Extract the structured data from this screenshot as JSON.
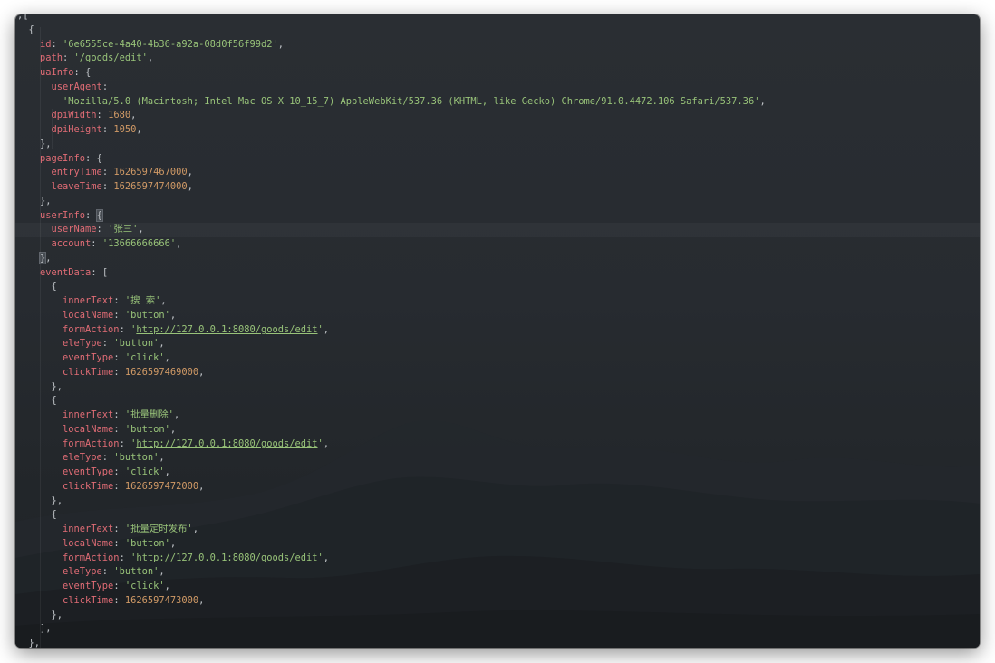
{
  "code": {
    "lines": [
      {
        "indent": 0,
        "parts": [
          {
            "t": "p",
            "v": ";["
          }
        ]
      },
      {
        "indent": 1,
        "parts": [
          {
            "t": "p",
            "v": "{"
          }
        ]
      },
      {
        "indent": 2,
        "parts": [
          {
            "t": "k",
            "v": "id"
          },
          {
            "t": "p",
            "v": ": "
          },
          {
            "t": "s",
            "v": "'6e6555ce-4a40-4b36-a92a-08d0f56f99d2'"
          },
          {
            "t": "p",
            "v": ","
          }
        ]
      },
      {
        "indent": 2,
        "parts": [
          {
            "t": "k",
            "v": "path"
          },
          {
            "t": "p",
            "v": ": "
          },
          {
            "t": "s",
            "v": "'/goods/edit'"
          },
          {
            "t": "p",
            "v": ","
          }
        ]
      },
      {
        "indent": 2,
        "parts": [
          {
            "t": "k",
            "v": "uaInfo"
          },
          {
            "t": "p",
            "v": ": {"
          }
        ]
      },
      {
        "indent": 3,
        "parts": [
          {
            "t": "k",
            "v": "userAgent"
          },
          {
            "t": "p",
            "v": ":"
          }
        ]
      },
      {
        "indent": 4,
        "parts": [
          {
            "t": "s",
            "v": "'Mozilla/5.0 (Macintosh; Intel Mac OS X 10_15_7) AppleWebKit/537.36 (KHTML, like Gecko) Chrome/91.0.4472.106 Safari/537.36'"
          },
          {
            "t": "p",
            "v": ","
          }
        ]
      },
      {
        "indent": 3,
        "parts": [
          {
            "t": "k",
            "v": "dpiWidth"
          },
          {
            "t": "p",
            "v": ": "
          },
          {
            "t": "n",
            "v": "1680"
          },
          {
            "t": "p",
            "v": ","
          }
        ]
      },
      {
        "indent": 3,
        "parts": [
          {
            "t": "k",
            "v": "dpiHeight"
          },
          {
            "t": "p",
            "v": ": "
          },
          {
            "t": "n",
            "v": "1050"
          },
          {
            "t": "p",
            "v": ","
          }
        ]
      },
      {
        "indent": 2,
        "parts": [
          {
            "t": "p",
            "v": "},"
          }
        ]
      },
      {
        "indent": 2,
        "parts": [
          {
            "t": "k",
            "v": "pageInfo"
          },
          {
            "t": "p",
            "v": ": {"
          }
        ]
      },
      {
        "indent": 3,
        "parts": [
          {
            "t": "k",
            "v": "entryTime"
          },
          {
            "t": "p",
            "v": ": "
          },
          {
            "t": "n",
            "v": "1626597467000"
          },
          {
            "t": "p",
            "v": ","
          }
        ]
      },
      {
        "indent": 3,
        "parts": [
          {
            "t": "k",
            "v": "leaveTime"
          },
          {
            "t": "p",
            "v": ": "
          },
          {
            "t": "n",
            "v": "1626597474000"
          },
          {
            "t": "p",
            "v": ","
          }
        ]
      },
      {
        "indent": 2,
        "parts": [
          {
            "t": "p",
            "v": "},"
          }
        ]
      },
      {
        "indent": 2,
        "parts": [
          {
            "t": "k",
            "v": "userInfo"
          },
          {
            "t": "p",
            "v": ": "
          },
          {
            "t": "c",
            "v": "{"
          }
        ]
      },
      {
        "indent": 3,
        "parts": [
          {
            "t": "k",
            "v": "userName"
          },
          {
            "t": "p",
            "v": ": "
          },
          {
            "t": "s",
            "v": "'张三'"
          },
          {
            "t": "p",
            "v": ","
          }
        ]
      },
      {
        "indent": 3,
        "parts": [
          {
            "t": "k",
            "v": "account"
          },
          {
            "t": "p",
            "v": ": "
          },
          {
            "t": "s",
            "v": "'13666666666'"
          },
          {
            "t": "p",
            "v": ","
          }
        ]
      },
      {
        "indent": 2,
        "parts": [
          {
            "t": "c",
            "v": "}"
          },
          {
            "t": "p",
            "v": ","
          }
        ]
      },
      {
        "indent": 2,
        "parts": [
          {
            "t": "k",
            "v": "eventData"
          },
          {
            "t": "p",
            "v": ": ["
          }
        ]
      },
      {
        "indent": 3,
        "parts": [
          {
            "t": "p",
            "v": "{"
          }
        ]
      },
      {
        "indent": 4,
        "parts": [
          {
            "t": "k",
            "v": "innerText"
          },
          {
            "t": "p",
            "v": ": "
          },
          {
            "t": "s",
            "v": "'搜 索'"
          },
          {
            "t": "p",
            "v": ","
          }
        ]
      },
      {
        "indent": 4,
        "parts": [
          {
            "t": "k",
            "v": "localName"
          },
          {
            "t": "p",
            "v": ": "
          },
          {
            "t": "s",
            "v": "'button'"
          },
          {
            "t": "p",
            "v": ","
          }
        ]
      },
      {
        "indent": 4,
        "parts": [
          {
            "t": "k",
            "v": "formAction"
          },
          {
            "t": "p",
            "v": ": "
          },
          {
            "t": "s",
            "v": "'"
          },
          {
            "t": "l",
            "v": "http://127.0.0.1:8080/goods/edit"
          },
          {
            "t": "s",
            "v": "'"
          },
          {
            "t": "p",
            "v": ","
          }
        ]
      },
      {
        "indent": 4,
        "parts": [
          {
            "t": "k",
            "v": "eleType"
          },
          {
            "t": "p",
            "v": ": "
          },
          {
            "t": "s",
            "v": "'button'"
          },
          {
            "t": "p",
            "v": ","
          }
        ]
      },
      {
        "indent": 4,
        "parts": [
          {
            "t": "k",
            "v": "eventType"
          },
          {
            "t": "p",
            "v": ": "
          },
          {
            "t": "s",
            "v": "'click'"
          },
          {
            "t": "p",
            "v": ","
          }
        ]
      },
      {
        "indent": 4,
        "parts": [
          {
            "t": "k",
            "v": "clickTime"
          },
          {
            "t": "p",
            "v": ": "
          },
          {
            "t": "n",
            "v": "1626597469000"
          },
          {
            "t": "p",
            "v": ","
          }
        ]
      },
      {
        "indent": 3,
        "parts": [
          {
            "t": "p",
            "v": "},"
          }
        ]
      },
      {
        "indent": 3,
        "parts": [
          {
            "t": "p",
            "v": "{"
          }
        ]
      },
      {
        "indent": 4,
        "parts": [
          {
            "t": "k",
            "v": "innerText"
          },
          {
            "t": "p",
            "v": ": "
          },
          {
            "t": "s",
            "v": "'批量删除'"
          },
          {
            "t": "p",
            "v": ","
          }
        ]
      },
      {
        "indent": 4,
        "parts": [
          {
            "t": "k",
            "v": "localName"
          },
          {
            "t": "p",
            "v": ": "
          },
          {
            "t": "s",
            "v": "'button'"
          },
          {
            "t": "p",
            "v": ","
          }
        ]
      },
      {
        "indent": 4,
        "parts": [
          {
            "t": "k",
            "v": "formAction"
          },
          {
            "t": "p",
            "v": ": "
          },
          {
            "t": "s",
            "v": "'"
          },
          {
            "t": "l",
            "v": "http://127.0.0.1:8080/goods/edit"
          },
          {
            "t": "s",
            "v": "'"
          },
          {
            "t": "p",
            "v": ","
          }
        ]
      },
      {
        "indent": 4,
        "parts": [
          {
            "t": "k",
            "v": "eleType"
          },
          {
            "t": "p",
            "v": ": "
          },
          {
            "t": "s",
            "v": "'button'"
          },
          {
            "t": "p",
            "v": ","
          }
        ]
      },
      {
        "indent": 4,
        "parts": [
          {
            "t": "k",
            "v": "eventType"
          },
          {
            "t": "p",
            "v": ": "
          },
          {
            "t": "s",
            "v": "'click'"
          },
          {
            "t": "p",
            "v": ","
          }
        ]
      },
      {
        "indent": 4,
        "parts": [
          {
            "t": "k",
            "v": "clickTime"
          },
          {
            "t": "p",
            "v": ": "
          },
          {
            "t": "n",
            "v": "1626597472000"
          },
          {
            "t": "p",
            "v": ","
          }
        ]
      },
      {
        "indent": 3,
        "parts": [
          {
            "t": "p",
            "v": "},"
          }
        ]
      },
      {
        "indent": 3,
        "parts": [
          {
            "t": "p",
            "v": "{"
          }
        ]
      },
      {
        "indent": 4,
        "parts": [
          {
            "t": "k",
            "v": "innerText"
          },
          {
            "t": "p",
            "v": ": "
          },
          {
            "t": "s",
            "v": "'批量定时发布'"
          },
          {
            "t": "p",
            "v": ","
          }
        ]
      },
      {
        "indent": 4,
        "parts": [
          {
            "t": "k",
            "v": "localName"
          },
          {
            "t": "p",
            "v": ": "
          },
          {
            "t": "s",
            "v": "'button'"
          },
          {
            "t": "p",
            "v": ","
          }
        ]
      },
      {
        "indent": 4,
        "parts": [
          {
            "t": "k",
            "v": "formAction"
          },
          {
            "t": "p",
            "v": ": "
          },
          {
            "t": "s",
            "v": "'"
          },
          {
            "t": "l",
            "v": "http://127.0.0.1:8080/goods/edit"
          },
          {
            "t": "s",
            "v": "'"
          },
          {
            "t": "p",
            "v": ","
          }
        ]
      },
      {
        "indent": 4,
        "parts": [
          {
            "t": "k",
            "v": "eleType"
          },
          {
            "t": "p",
            "v": ": "
          },
          {
            "t": "s",
            "v": "'button'"
          },
          {
            "t": "p",
            "v": ","
          }
        ]
      },
      {
        "indent": 4,
        "parts": [
          {
            "t": "k",
            "v": "eventType"
          },
          {
            "t": "p",
            "v": ": "
          },
          {
            "t": "s",
            "v": "'click'"
          },
          {
            "t": "p",
            "v": ","
          }
        ]
      },
      {
        "indent": 4,
        "parts": [
          {
            "t": "k",
            "v": "clickTime"
          },
          {
            "t": "p",
            "v": ": "
          },
          {
            "t": "n",
            "v": "1626597473000"
          },
          {
            "t": "p",
            "v": ","
          }
        ]
      },
      {
        "indent": 3,
        "parts": [
          {
            "t": "p",
            "v": "},"
          }
        ]
      },
      {
        "indent": 2,
        "parts": [
          {
            "t": "p",
            "v": "],"
          }
        ]
      },
      {
        "indent": 1,
        "parts": [
          {
            "t": "p",
            "v": "},"
          }
        ]
      }
    ]
  },
  "theme": {
    "key_color": "#e06c75",
    "string_color": "#98c379",
    "number_color": "#d19a66",
    "text_color": "#c5c8c6",
    "background": "#272b30"
  },
  "active_line": 15
}
